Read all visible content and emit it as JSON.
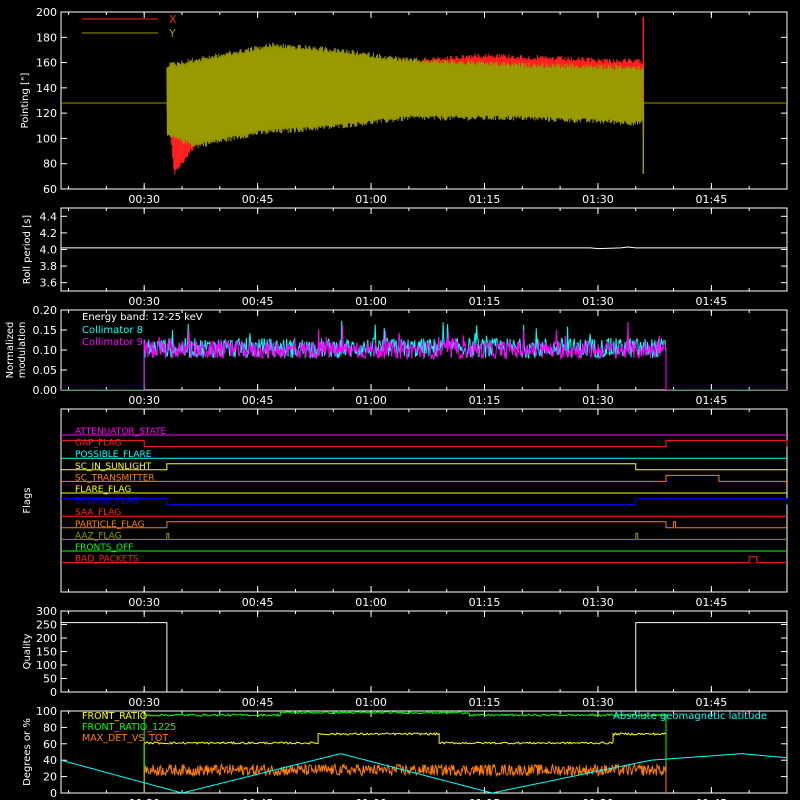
{
  "chart_data": [
    {
      "type": "line",
      "ylabel": "Pointing [\"]",
      "ylim": [
        60,
        200
      ],
      "yticks": [
        "60",
        "80",
        "100",
        "120",
        "140",
        "160",
        "180",
        "200"
      ],
      "xticks": [
        "00:30",
        "00:45",
        "01:00",
        "01:15",
        "01:30",
        "01:45"
      ],
      "xlim": [
        "00:19",
        "01:55"
      ],
      "legend": "top-left",
      "series": [
        {
          "name": "X",
          "color": "#ff2020",
          "baseline": 128,
          "active_start": "00:33",
          "active_end": "01:36",
          "upper_envelope": [
            [
              "00:33",
              130
            ],
            [
              "00:34",
              148
            ],
            [
              "00:40",
              158
            ],
            [
              "00:50",
              162
            ],
            [
              "01:05",
              163
            ],
            [
              "01:15",
              168
            ],
            [
              "01:25",
              165
            ],
            [
              "01:35",
              163
            ]
          ],
          "lower_envelope": [
            [
              "00:33",
              128
            ],
            [
              "00:34",
              70
            ],
            [
              "00:37",
              95
            ],
            [
              "00:45",
              112
            ],
            [
              "00:55",
              117
            ],
            [
              "01:05",
              121
            ],
            [
              "01:20",
              118
            ],
            [
              "01:35",
              118
            ]
          ]
        },
        {
          "name": "Y",
          "color": "#999900",
          "baseline": 128,
          "active_start": "00:33",
          "active_end": "01:36",
          "upper_envelope": [
            [
              "00:33",
              160
            ],
            [
              "00:40",
              168
            ],
            [
              "00:47",
              176
            ],
            [
              "00:55",
              172
            ],
            [
              "01:05",
              164
            ],
            [
              "01:20",
              160
            ],
            [
              "01:35",
              158
            ]
          ],
          "lower_envelope": [
            [
              "00:33",
              100
            ],
            [
              "00:37",
              92
            ],
            [
              "00:45",
              102
            ],
            [
              "00:55",
              107
            ],
            [
              "01:05",
              114
            ],
            [
              "01:20",
              114
            ],
            [
              "01:35",
              110
            ]
          ]
        }
      ]
    },
    {
      "type": "line",
      "ylabel": "Roll period [s]",
      "ylim": [
        3.5,
        4.5
      ],
      "yticks": [
        "3.6",
        "3.8",
        "4.0",
        "4.2",
        "4.4"
      ],
      "xticks": [
        "00:30",
        "00:45",
        "01:00",
        "01:15",
        "01:30",
        "01:45"
      ],
      "series": [
        {
          "name": "",
          "color": "#ffffff",
          "points": [
            [
              "00:19",
              4.02
            ],
            [
              "01:29",
              4.02
            ],
            [
              "01:30",
              4.01
            ],
            [
              "01:33",
              4.02
            ],
            [
              "01:34",
              4.03
            ],
            [
              "01:35",
              4.02
            ],
            [
              "01:55",
              4.02
            ]
          ]
        }
      ]
    },
    {
      "type": "line",
      "ylabel": "Normalized modulation",
      "ylim": [
        0,
        0.2
      ],
      "yticks": [
        "0.00",
        "0.05",
        "0.10",
        "0.15",
        "0.20"
      ],
      "xticks": [
        "00:30",
        "00:45",
        "01:00",
        "01:15",
        "01:30",
        "01:45"
      ],
      "legend": "top-left",
      "annotation": "Energy band: 12-25 keV",
      "series": [
        {
          "name": "Collimator 8",
          "color": "#00ffff",
          "active_start": "00:30",
          "active_end": "01:39",
          "mean": 0.105,
          "spread": 0.05
        },
        {
          "name": "Collimator 9",
          "color": "#ff00ff",
          "active_start": "00:30",
          "active_end": "01:39",
          "mean": 0.1,
          "spread": 0.045
        }
      ]
    },
    {
      "type": "line",
      "ylabel": "Flags",
      "xticks": [
        "00:30",
        "00:45",
        "01:00",
        "01:15",
        "01:30",
        "01:45"
      ],
      "series": [
        {
          "name": "ATTENUATOR_STATE",
          "color": "#ff00ff",
          "low": true,
          "high_intervals": []
        },
        {
          "name": "GAP_FLAG",
          "color": "#ff2020",
          "high_intervals": [
            [
              "00:19",
              "00:30"
            ],
            [
              "01:39",
              "01:55"
            ]
          ]
        },
        {
          "name": "POSSIBLE_FLARE",
          "color": "#00ffff",
          "high_intervals": []
        },
        {
          "name": "SC_IN_SUNLIGHT",
          "color": "#ffff00",
          "high_intervals": [
            [
              "00:33",
              "01:35"
            ]
          ]
        },
        {
          "name": "SC_TRANSMITTER",
          "color": "#ff8000",
          "high_intervals": [
            [
              "01:39",
              "01:46"
            ]
          ]
        },
        {
          "name": "FLARE_FLAG",
          "color": "#ffff00",
          "high_intervals": []
        },
        {
          "name": "ECLIPSE_FLAG",
          "color": "#0000ff",
          "high_intervals": [
            [
              "00:19",
              "00:33"
            ],
            [
              "01:35",
              "01:55"
            ]
          ]
        },
        {
          "name": "SAA_FLAG",
          "color": "#ff2020",
          "high_intervals": []
        },
        {
          "name": "PARTICLE_FLAG",
          "color": "#ff8000",
          "high_intervals": [
            [
              "00:33",
              "01:39"
            ],
            [
              "01:40",
              "01:40"
            ]
          ]
        },
        {
          "name": "AAZ_FLAG",
          "color": "#999900",
          "high_intervals": [
            [
              "00:33",
              "00:33"
            ],
            [
              "01:35",
              "01:35"
            ]
          ]
        },
        {
          "name": "FRONTS_OFF",
          "color": "#00ff00",
          "high_intervals": []
        },
        {
          "name": "BAD_PACKETS",
          "color": "#ff2020",
          "high_intervals": [
            [
              "01:50",
              "01:51"
            ]
          ]
        }
      ]
    },
    {
      "type": "line",
      "ylabel": "Quality",
      "ylim": [
        0,
        300
      ],
      "yticks": [
        "0",
        "50",
        "100",
        "150",
        "200",
        "250",
        "300"
      ],
      "xticks": [
        "00:30",
        "00:45",
        "01:00",
        "01:15",
        "01:30",
        "01:45"
      ],
      "series": [
        {
          "name": "",
          "color": "#ffffff",
          "points": [
            [
              "00:19",
              257
            ],
            [
              "00:33",
              257
            ],
            [
              "00:33",
              0
            ],
            [
              "01:35",
              0
            ],
            [
              "01:35",
              257
            ],
            [
              "01:55",
              257
            ]
          ]
        }
      ]
    },
    {
      "type": "line",
      "ylabel": "Degrees or %",
      "ylim": [
        0,
        100
      ],
      "yticks": [
        "0",
        "20",
        "40",
        "60",
        "80",
        "100"
      ],
      "xticks": [
        "00:30",
        "00:45",
        "01:00",
        "01:15",
        "01:30",
        "01:45"
      ],
      "legend": "top-left",
      "series": [
        {
          "name": "FRONT_RATIO",
          "color": "#ffff00",
          "segments": [
            [
              "00:30",
              "00:53",
              61
            ],
            [
              "00:53",
              "01:09",
              72
            ],
            [
              "01:09",
              "01:32",
              61
            ],
            [
              "01:32",
              "01:39",
              72
            ]
          ]
        },
        {
          "name": "FRONT_RATIO_1225",
          "color": "#00ff00",
          "segments": [
            [
              "00:30",
              "00:48",
              95
            ],
            [
              "00:48",
              "01:13",
              98
            ],
            [
              "01:13",
              "01:39",
              95
            ]
          ]
        },
        {
          "name": "MAX_DET_VS_TOT",
          "color": "#ff8000",
          "active_start": "00:30",
          "active_end": "01:39",
          "mean": 28,
          "spread": 7
        },
        {
          "name": "Absolute geomagnetic latitude",
          "color": "#00ffff",
          "points": [
            [
              "00:19",
              40
            ],
            [
              "00:35",
              0
            ],
            [
              "00:56",
              48
            ],
            [
              "01:16",
              0
            ],
            [
              "01:37",
              40
            ],
            [
              "01:49",
              48
            ],
            [
              "01:55",
              43
            ]
          ]
        }
      ]
    }
  ]
}
